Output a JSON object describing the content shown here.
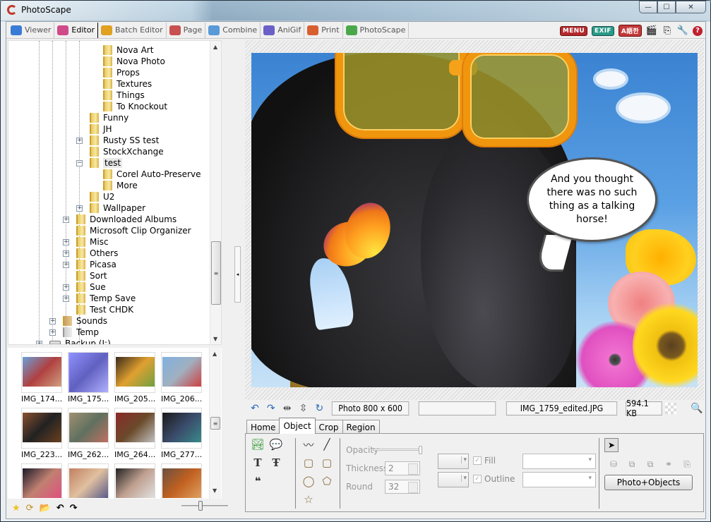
{
  "window": {
    "title": "PhotoScape",
    "controls": {
      "minimize": "—",
      "maximize": "☐",
      "close": "✕"
    }
  },
  "main_tabs": [
    {
      "label": "Viewer",
      "icon": "viewer-icon",
      "color": "#3a7bd5",
      "active": false
    },
    {
      "label": "Editor",
      "icon": "editor-icon",
      "color": "#d04a8a",
      "active": true
    },
    {
      "label": "Batch Editor",
      "icon": "batch-editor-icon",
      "color": "#e0a020",
      "active": false
    },
    {
      "label": "Page",
      "icon": "page-icon",
      "color": "#c85050",
      "active": false
    },
    {
      "label": "Combine",
      "icon": "combine-icon",
      "color": "#5a9ad8",
      "active": false
    },
    {
      "label": "AniGif",
      "icon": "anigif-icon",
      "color": "#6a60c8",
      "active": false
    },
    {
      "label": "Print",
      "icon": "print-icon",
      "color": "#d86030",
      "active": false
    },
    {
      "label": "PhotoScape",
      "icon": "photoscape-icon",
      "color": "#4aa84a",
      "active": false
    }
  ],
  "top_icons": {
    "menu": "MENU",
    "exif": "EXIF",
    "language": "A語한",
    "slideshow_icon": "🎬",
    "copy_icon": "⎘",
    "tools_icon": "🔧",
    "help_icon": "?"
  },
  "folder_tree": [
    {
      "label": "Nova Art",
      "depth": 4,
      "toggle": null,
      "kind": "folder"
    },
    {
      "label": "Nova Photo",
      "depth": 4,
      "toggle": null,
      "kind": "folder"
    },
    {
      "label": "Props",
      "depth": 4,
      "toggle": null,
      "kind": "folder"
    },
    {
      "label": "Textures",
      "depth": 4,
      "toggle": null,
      "kind": "folder"
    },
    {
      "label": "Things",
      "depth": 4,
      "toggle": null,
      "kind": "folder"
    },
    {
      "label": "To Knockout",
      "depth": 4,
      "toggle": null,
      "kind": "folder"
    },
    {
      "label": "Funny",
      "depth": 3,
      "toggle": null,
      "kind": "folder"
    },
    {
      "label": "JH",
      "depth": 3,
      "toggle": null,
      "kind": "folder"
    },
    {
      "label": "Rusty SS test",
      "depth": 3,
      "toggle": "+",
      "kind": "folder"
    },
    {
      "label": "StockXchange",
      "depth": 3,
      "toggle": null,
      "kind": "folder"
    },
    {
      "label": "test",
      "depth": 3,
      "toggle": "−",
      "kind": "folder",
      "selected": true
    },
    {
      "label": "Corel Auto-Preserve",
      "depth": 4,
      "toggle": null,
      "kind": "folder"
    },
    {
      "label": "More",
      "depth": 4,
      "toggle": null,
      "kind": "folder"
    },
    {
      "label": "U2",
      "depth": 3,
      "toggle": null,
      "kind": "folder"
    },
    {
      "label": "Wallpaper",
      "depth": 3,
      "toggle": "+",
      "kind": "folder"
    },
    {
      "label": "Downloaded Albums",
      "depth": 2,
      "toggle": "+",
      "kind": "folder"
    },
    {
      "label": "Microsoft Clip Organizer",
      "depth": 2,
      "toggle": null,
      "kind": "folder"
    },
    {
      "label": "Misc",
      "depth": 2,
      "toggle": "+",
      "kind": "folder"
    },
    {
      "label": "Others",
      "depth": 2,
      "toggle": "+",
      "kind": "folder"
    },
    {
      "label": "Picasa",
      "depth": 2,
      "toggle": "+",
      "kind": "folder"
    },
    {
      "label": "Sort",
      "depth": 2,
      "toggle": null,
      "kind": "folder"
    },
    {
      "label": "Sue",
      "depth": 2,
      "toggle": "+",
      "kind": "folder"
    },
    {
      "label": "Temp Save",
      "depth": 2,
      "toggle": "+",
      "kind": "folder"
    },
    {
      "label": "Test CHDK",
      "depth": 2,
      "toggle": null,
      "kind": "folder"
    },
    {
      "label": "Sounds",
      "depth": 1,
      "toggle": "+",
      "kind": "music"
    },
    {
      "label": "Temp",
      "depth": 1,
      "toggle": "+",
      "kind": "file"
    },
    {
      "label": "Backup (I:)",
      "depth": 0,
      "toggle": "+",
      "kind": "drive"
    }
  ],
  "thumbnails": [
    {
      "label": "IMG_174...",
      "colors": [
        "#6aa0d8",
        "#b04040",
        "#d0a080"
      ]
    },
    {
      "label": "IMG_175...",
      "colors": [
        "#9090ff",
        "#6060c0",
        "#b0b0ff"
      ],
      "selected": true
    },
    {
      "label": "IMG_205...",
      "colors": [
        "#3a2a1a",
        "#e0a030",
        "#70a040"
      ]
    },
    {
      "label": "IMG_206...",
      "colors": [
        "#80b0e0",
        "#a0b0c0",
        "#d04040"
      ]
    },
    {
      "label": "IMG_223...",
      "colors": [
        "#8a5030",
        "#222222",
        "#6a4020"
      ]
    },
    {
      "label": "IMG_262...",
      "colors": [
        "#a09070",
        "#607060",
        "#c07060"
      ]
    },
    {
      "label": "IMG_264...",
      "colors": [
        "#8a2a2a",
        "#6a4a2a",
        "#c0c0c0"
      ]
    },
    {
      "label": "IMG_277...",
      "colors": [
        "#1a1a1a",
        "#3a4a6a",
        "#3a8a8a"
      ]
    },
    {
      "label": "",
      "colors": [
        "#1a1a2a",
        "#c08070",
        "#e05080"
      ]
    },
    {
      "label": "",
      "colors": [
        "#c08060",
        "#e0c0a0",
        "#5a5a8a"
      ]
    },
    {
      "label": "",
      "colors": [
        "#222222",
        "#c0a090",
        "#e0e0e0"
      ]
    },
    {
      "label": "",
      "colors": [
        "#6a5040",
        "#c06020",
        "#e0a060"
      ]
    }
  ],
  "bottom_tools": {
    "favorite_icon": "★",
    "refresh_icon": "⟳",
    "browse_folder_icon": "📂",
    "back_icon": "↶",
    "forward_icon": "↷",
    "thumb_size": 0.4
  },
  "canvas": {
    "speech_bubble": "And you thought there was no such thing as a talking horse!",
    "colors": {
      "sky_top": "#3b83d2",
      "sky_bottom": "#c8e2f6",
      "glasses": "#f0960e",
      "lens": "#a09628"
    }
  },
  "status": {
    "undo_icon": "↶",
    "redo_icon": "↷",
    "flip_h_icon": "⇹",
    "flip_v_icon": "⇳",
    "rotate_icon": "↻",
    "photo_size": "Photo 800 x 600",
    "empty": "",
    "filename": "IMG_1759_edited.JPG",
    "filesize": "594.1 KB",
    "zoom_icon": "🔍"
  },
  "editor_tabs": [
    {
      "label": "Home",
      "active": false
    },
    {
      "label": "Object",
      "active": true
    },
    {
      "label": "Crop",
      "active": false
    },
    {
      "label": "Region",
      "active": false
    }
  ],
  "object_panel": {
    "opacity_label": "Opacity",
    "opacity_value": 1.0,
    "thickness_label": "Thickness",
    "thickness_value": "2",
    "round_label": "Round",
    "round_value": "32",
    "fill_label": "Fill",
    "fill_checked": true,
    "outline_label": "Outline",
    "outline_checked": true,
    "photo_objects_button": "Photo+Objects",
    "tools": {
      "photo": "🏞",
      "balloon": "💬",
      "text": "T",
      "text_outline": "Ŧ",
      "quote": "❝",
      "free_line": "〰",
      "line": "╱",
      "rect": "▢",
      "rounded_rect": "▢",
      "ellipse": "◯",
      "pentagon": "⬠",
      "star": "☆",
      "select": "➤"
    },
    "arrange_icons": [
      "⛁",
      "⧉",
      "⧉",
      "⚭",
      "⎘"
    ]
  }
}
